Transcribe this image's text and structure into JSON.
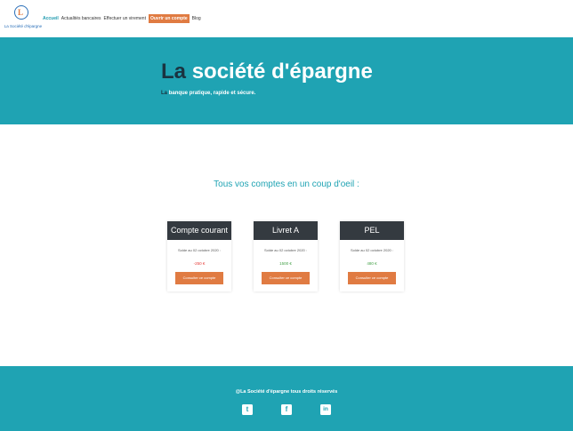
{
  "brand": {
    "logo_letters": "L",
    "logo_text": "La Société d'épargne"
  },
  "nav": {
    "items": [
      "Accueil",
      "Actualités bancaires",
      "Effectuer un virement"
    ],
    "cta": "Ouvrir un compte",
    "blog": "Blog"
  },
  "hero": {
    "title_prefix": "La",
    "title_rest": "société d'épargne",
    "subtitle_prefix": "La",
    "subtitle_rest": "banque pratique, rapide et sécure."
  },
  "main": {
    "heading": "Tous vos comptes en un coup d'oeil :"
  },
  "accounts": [
    {
      "name": "Compte courant",
      "date": "Solde au 02 octobre 2020 :",
      "amount": "-250 €",
      "amount_color": "#e53935",
      "button": "Consulter ce compte"
    },
    {
      "name": "Livret A",
      "date": "Solde au 02 octobre 2020 :",
      "amount": "1500 €",
      "amount_color": "#43a047",
      "button": "Consulter ce compte"
    },
    {
      "name": "PEL",
      "date": "Solde au 02 octobre 2020 :",
      "amount": "480 €",
      "amount_color": "#43a047",
      "button": "Consulter ce compte"
    }
  ],
  "footer": {
    "text": "@La Société d'épargne tous droits réservés",
    "social": [
      {
        "icon": "twitter-icon",
        "glyph": "t"
      },
      {
        "icon": "facebook-icon",
        "glyph": "f"
      },
      {
        "icon": "linkedin-icon",
        "glyph": "in"
      }
    ]
  }
}
